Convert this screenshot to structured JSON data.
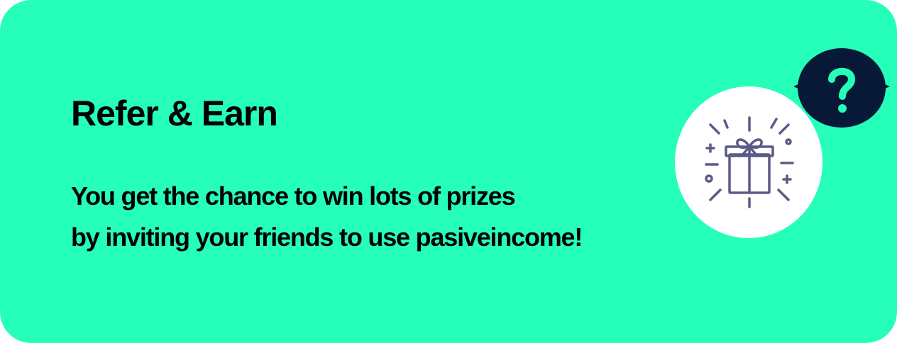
{
  "referral_card": {
    "title": "Refer & Earn",
    "description_lines": [
      "You get the chance to win lots of prizes",
      "by inviting your friends to use pasiveincome!"
    ],
    "icon": "gift-icon",
    "help_icon": "question-mark-icon"
  },
  "colors": {
    "card_background": "#26ffb9",
    "help_bubble": "#071936",
    "help_glyph": "#26ffb9",
    "gift_stroke": "#5a5c86"
  }
}
